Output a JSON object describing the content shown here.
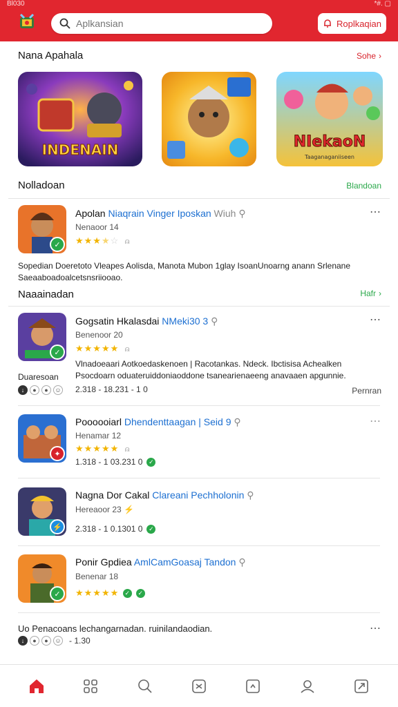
{
  "status": {
    "left": "Bl030",
    "right": "*#. ▢"
  },
  "header": {
    "search_placeholder": "Aplkansian",
    "button_label": "Roplkaqian",
    "brand_color": "#e1262f"
  },
  "featured": {
    "title": "Nana Apahala",
    "link": "Sohe",
    "banners": [
      {
        "caption": "INDENAIN"
      },
      {
        "caption": ""
      },
      {
        "caption": "NIekaoN",
        "sub": "Taaganaganiiseen"
      }
    ]
  },
  "section2": {
    "title": "Nolladoan",
    "link": "Blandoan"
  },
  "app1": {
    "name": "Apolan",
    "dev": "Niaqrain Vinger Iposkan",
    "extra": "Wiuh",
    "meta": "Nenaoor 14",
    "rating": 3.5,
    "desc": "Sopedian Doeretoto Vleapes Aolisda, Manota Mubon 1glay IsoanUnoarng anann Srlenane Saeaaboadoalcetsnsriiooao."
  },
  "section3": {
    "title": "Naaainadan",
    "link": "Hafr"
  },
  "apps": [
    {
      "name": "Gogsatin Hkalasdai",
      "dev": "NMeki30 3",
      "meta": "Benenoor 20",
      "rating": 5,
      "desc": "Vlnadoeaari Aotkoedaskenoen | Racotankas. Ndeck. Ibctisisa Achealken Psocdoarn oduateruiddoniaoddone tsanearienaeeng anavaaen apgunnie.",
      "label": "Duaresoan",
      "size": "2.318 - 18.231 - 1 0",
      "right": "Pernran"
    },
    {
      "name": "Poooooiarl",
      "dev": "Dhendenttaagan | Seid 9",
      "meta": "Henamar 12",
      "rating": 5,
      "size": "1.318 - 1 03.231 0"
    },
    {
      "name": "Nagna Dor Cakal",
      "dev": "Clareani Pechholonin",
      "meta": "Hereaoor 23",
      "rating": 0,
      "size": "2.318 - 1 0.1301 0"
    },
    {
      "name": "Ponir Gpdiea",
      "dev": "AmlCamGoasaj Tandon",
      "meta": "Benenar 18",
      "rating": 5
    }
  ],
  "footer_item": {
    "text": "Uo Penacoans lechangarnadan. ruinilandaodian.",
    "size": "- 1.30"
  },
  "nav": [
    "home-icon",
    "apps-icon",
    "search-icon",
    "games-icon",
    "updates-icon",
    "profile-icon",
    "library-icon"
  ]
}
